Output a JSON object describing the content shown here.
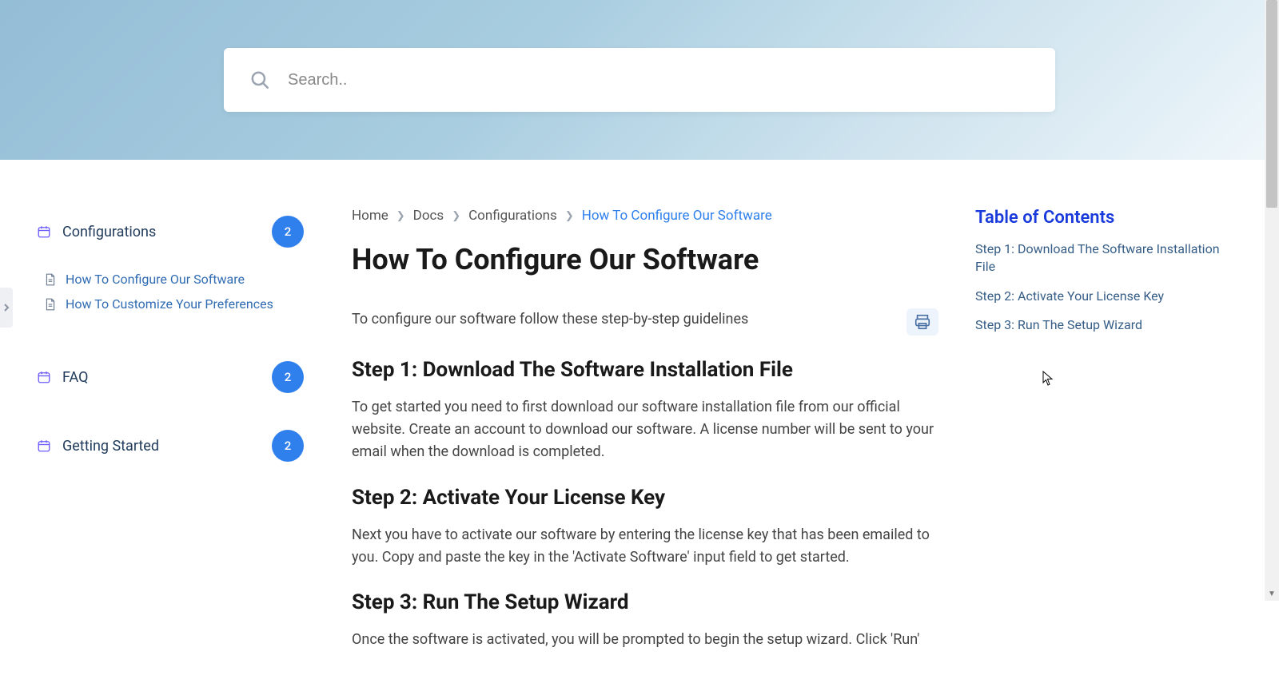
{
  "search": {
    "placeholder": "Search.."
  },
  "sidebar": {
    "categories": [
      {
        "label": "Configurations",
        "count": "2"
      },
      {
        "label": "FAQ",
        "count": "2"
      },
      {
        "label": "Getting Started",
        "count": "2"
      }
    ],
    "config_children": [
      {
        "label": "How To Configure Our Software"
      },
      {
        "label": "How To Customize Your Preferences"
      }
    ]
  },
  "breadcrumb": {
    "items": [
      "Home",
      "Docs",
      "Configurations"
    ],
    "current": "How To Configure Our Software"
  },
  "article": {
    "title": "How To Configure Our Software",
    "intro": "To configure our software follow these step-by-step guidelines",
    "steps": [
      {
        "heading": "Step 1: Download The Software Installation File",
        "body": "To get started you need to first download our software installation file from our official website. Create an account to download our software. A license number will be sent to your email when the download is completed."
      },
      {
        "heading": "Step 2: Activate Your License Key",
        "body": "Next you have to activate our software by entering the license key that has been emailed to you. Copy and paste the key in the 'Activate Software' input field to get started."
      },
      {
        "heading": "Step 3: Run The Setup Wizard",
        "body": "Once the software is activated, you will be prompted to begin the setup wizard. Click 'Run'"
      }
    ]
  },
  "toc": {
    "title": "Table of Contents",
    "items": [
      "Step 1: Download The Software Installation File",
      "Step 2: Activate Your License Key",
      "Step 3: Run The Setup Wizard"
    ]
  }
}
